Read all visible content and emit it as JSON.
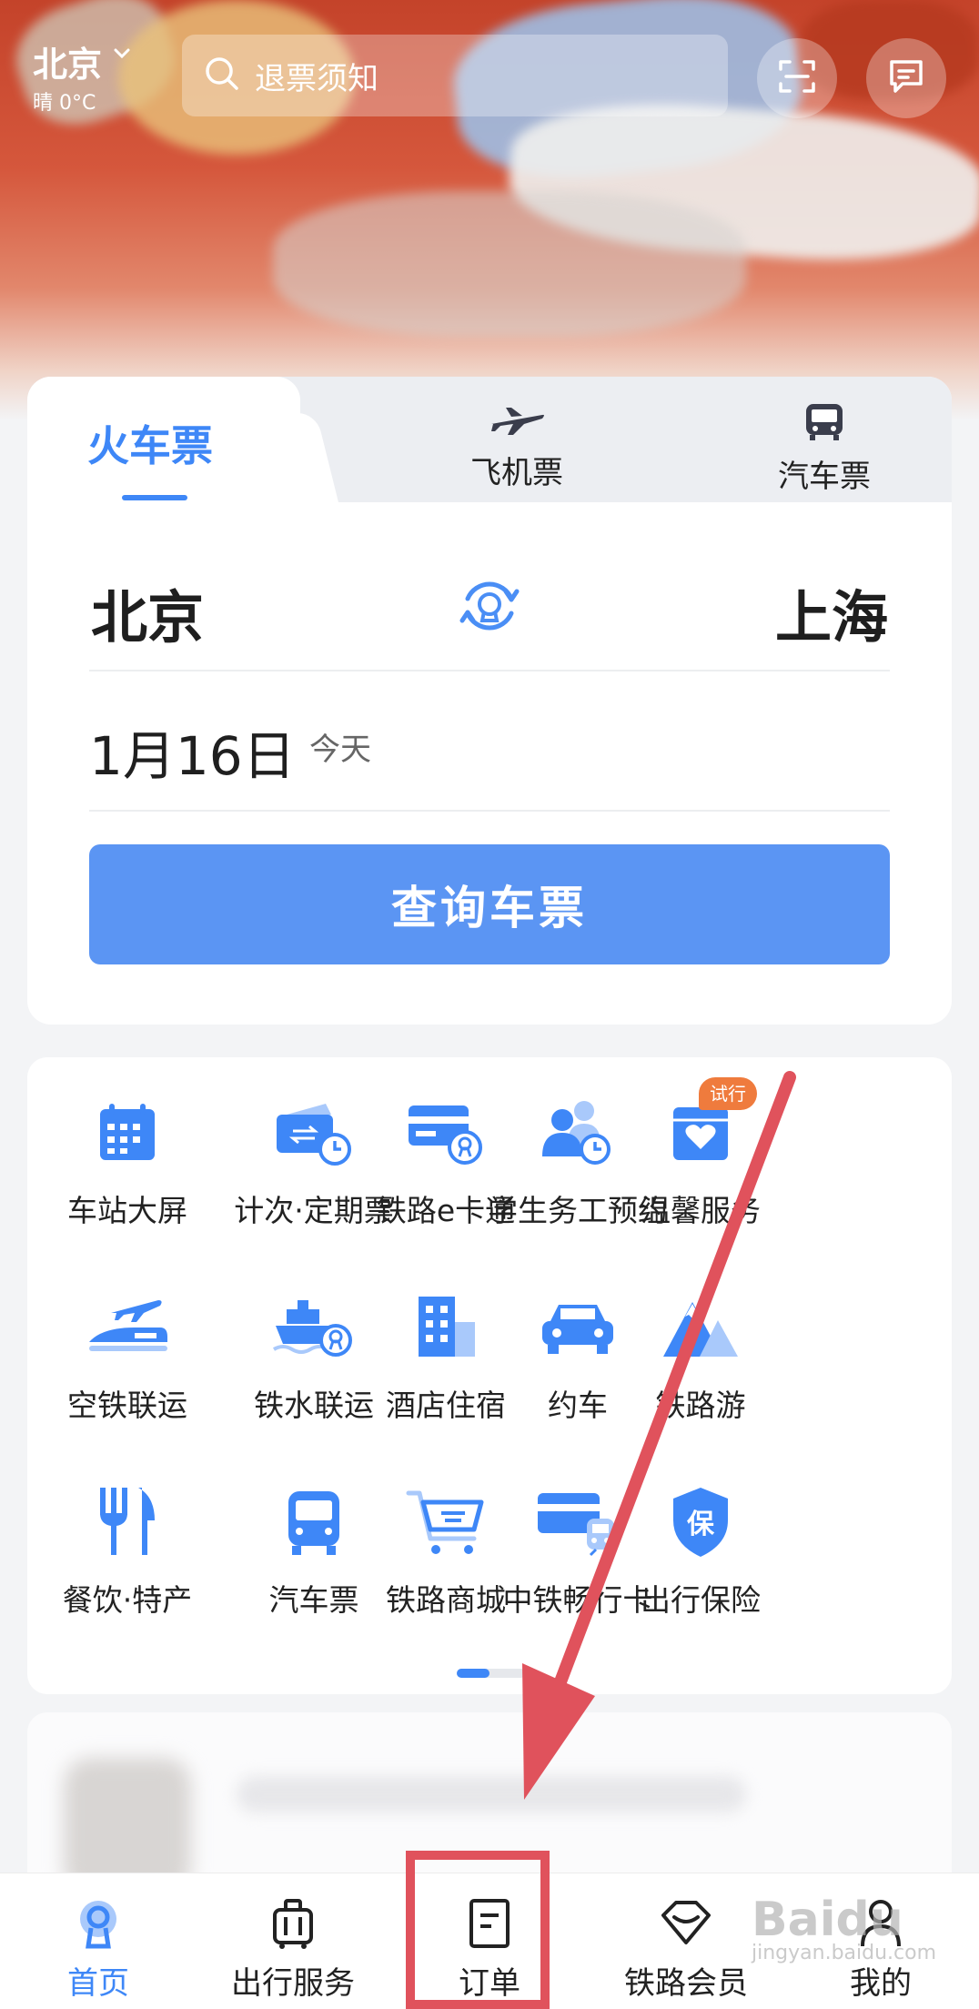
{
  "header": {
    "city": "北京",
    "weather": "晴 0°C",
    "search_placeholder": "退票须知"
  },
  "ticket": {
    "tabs": [
      {
        "label": "火车票",
        "icon": "train-icon"
      },
      {
        "label": "飞机票",
        "icon": "airplane-icon"
      },
      {
        "label": "汽车票",
        "icon": "bus-icon"
      }
    ],
    "active_tab": "火车票",
    "from": "北京",
    "to": "上海",
    "date": "1月16日",
    "date_tag": "今天",
    "query_label": "查询车票"
  },
  "services": {
    "items": [
      {
        "label": "车站大屏",
        "icon": "calendar-screen-icon"
      },
      {
        "label": "计次·定期票",
        "icon": "ticket-clock-icon"
      },
      {
        "label": "铁路e卡通",
        "icon": "railway-card-icon"
      },
      {
        "label": "学生务工预约",
        "icon": "people-clock-icon"
      },
      {
        "label": "温馨服务",
        "icon": "heart-box-icon"
      },
      {
        "label": "空铁联运",
        "icon": "plane-train-icon"
      },
      {
        "label": "铁水联运",
        "icon": "ship-train-icon"
      },
      {
        "label": "酒店住宿",
        "icon": "hotel-building-icon"
      },
      {
        "label": "约车",
        "icon": "car-icon"
      },
      {
        "label": "铁路游",
        "icon": "mountain-icon"
      },
      {
        "label": "餐饮·特产",
        "icon": "fork-knife-icon"
      },
      {
        "label": "汽车票",
        "icon": "bus-front-icon"
      },
      {
        "label": "铁路商城",
        "icon": "shopping-cart-icon"
      },
      {
        "label": "中铁畅行卡",
        "icon": "card-train-icon"
      },
      {
        "label": "出行保险",
        "icon": "insurance-shield-icon"
      }
    ],
    "badge": "试行",
    "badge_on": "学生务工预约",
    "page_index": 1,
    "page_count": 2
  },
  "nav": {
    "items": [
      {
        "label": "首页",
        "icon": "railway-logo-icon"
      },
      {
        "label": "出行服务",
        "icon": "luggage-icon"
      },
      {
        "label": "订单",
        "icon": "order-doc-icon"
      },
      {
        "label": "铁路会员",
        "icon": "diamond-icon"
      },
      {
        "label": "我的",
        "icon": "person-icon"
      }
    ],
    "active": "首页"
  },
  "colors": {
    "accent": "#3e87f7",
    "button": "#5b95f3",
    "badge": "#ef7b3d",
    "annotation": "#e0525c"
  },
  "watermark": {
    "brand": "Baidu",
    "sub": "jingyan.baidu.com"
  }
}
